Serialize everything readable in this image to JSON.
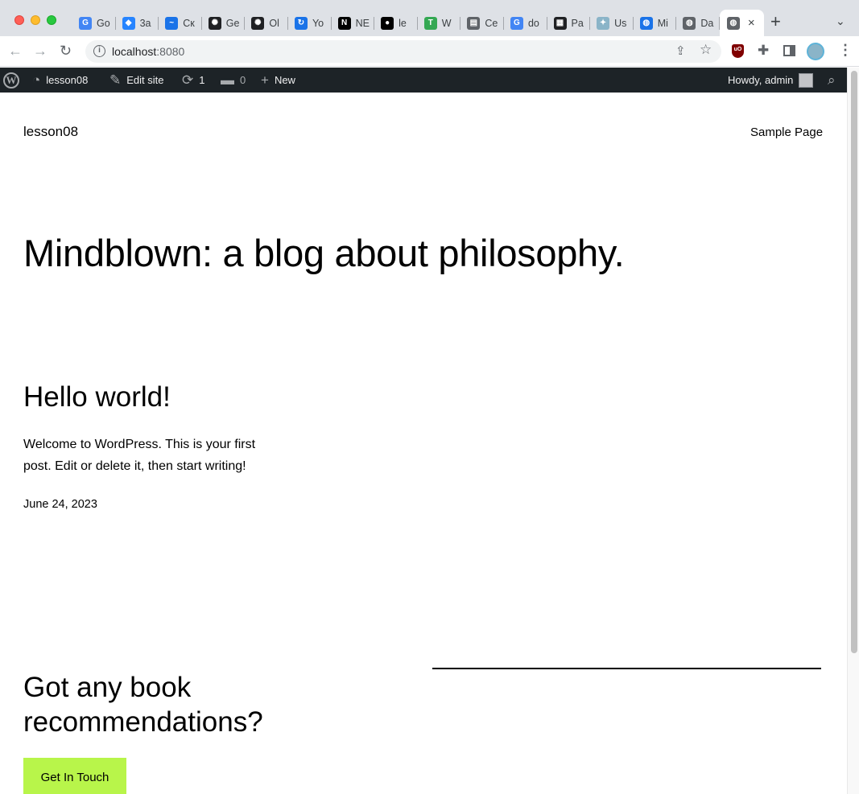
{
  "browser": {
    "tabs": [
      {
        "label": "Go",
        "icon": "google-translate-icon",
        "color": "#4285f4"
      },
      {
        "label": "3a",
        "icon": "jira-icon",
        "color": "#2684ff"
      },
      {
        "label": "Cк",
        "icon": "swoosh-icon",
        "color": "#1a73e8"
      },
      {
        "label": "Ge",
        "icon": "openai-icon",
        "color": "#202124"
      },
      {
        "label": "Ol",
        "icon": "openai-icon",
        "color": "#202124"
      },
      {
        "label": "Yo",
        "icon": "refresh-circle-icon",
        "color": "#1a73e8"
      },
      {
        "label": "NE",
        "icon": "notion-icon",
        "color": "#000000"
      },
      {
        "label": "le",
        "icon": "github-icon",
        "color": "#000000"
      },
      {
        "label": "W",
        "icon": "table-icon",
        "color": "#34a853"
      },
      {
        "label": "Ce",
        "icon": "document-icon",
        "color": "#5f6368"
      },
      {
        "label": "do",
        "icon": "google-icon",
        "color": "#4285f4"
      },
      {
        "label": "Pa",
        "icon": "calendar-icon",
        "color": "#202124"
      },
      {
        "label": "Us",
        "icon": "bird-icon",
        "color": "#8ab4c8"
      },
      {
        "label": "Mi",
        "icon": "globe-blue-icon",
        "color": "#1a73e8"
      },
      {
        "label": "Da",
        "icon": "globe-icon",
        "color": "#5f6368"
      }
    ],
    "active_tab": {
      "icon": "globe-icon",
      "close": "×"
    },
    "new_tab": "+",
    "url_host": "localhost",
    "url_port": ":8080"
  },
  "adminbar": {
    "site_name": "lesson08",
    "edit_site": "Edit site",
    "updates_count": "1",
    "comments_count": "0",
    "new_label": "New",
    "howdy": "Howdy, admin"
  },
  "site": {
    "title": "lesson08",
    "nav_item": "Sample Page",
    "hero": "Mindblown: a blog about philosophy.",
    "post": {
      "title": "Hello world!",
      "excerpt": "Welcome to WordPress. This is your first post. Edit or delete it, then start writing!",
      "date": "June 24, 2023"
    },
    "cta": {
      "heading": "Got any book recommendations?",
      "button": "Get In Touch",
      "button_color": "#b8f54a"
    }
  }
}
